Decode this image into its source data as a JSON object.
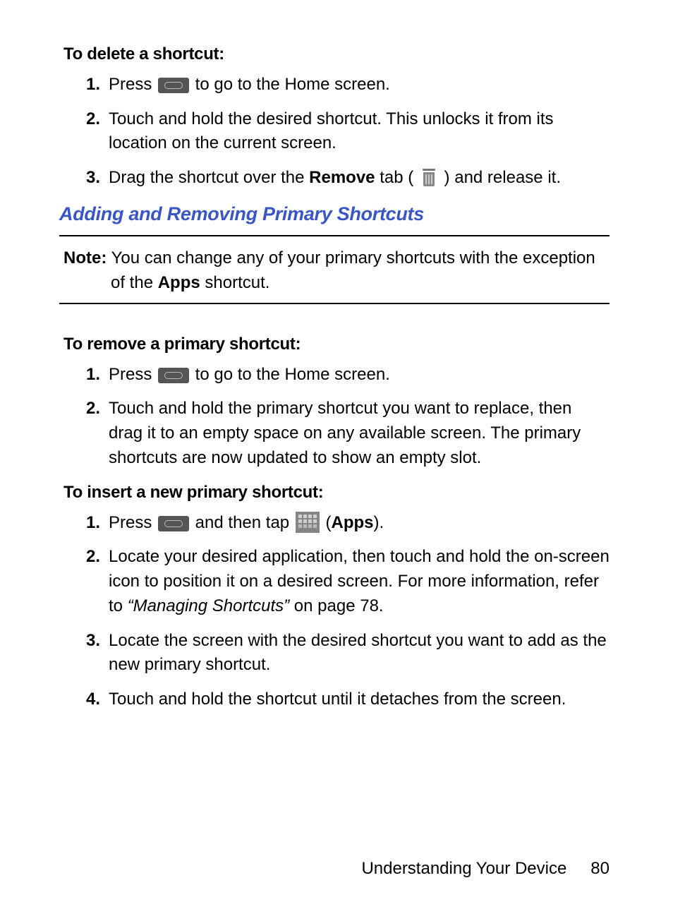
{
  "sec1": {
    "heading": "To delete a shortcut:",
    "items": {
      "i1a": "Press ",
      "i1b": " to go to the Home screen.",
      "i2": "Touch and hold the desired shortcut. This unlocks it from its location on the current screen.",
      "i3a": "Drag the shortcut over the ",
      "i3bold": "Remove",
      "i3b": " tab ( ",
      "i3c": " ) and release it."
    }
  },
  "blueHeading": "Adding and Removing Primary Shortcuts",
  "note": {
    "label": "Note:",
    "text1": " You can change any of your primary shortcuts with the exception of the ",
    "bold": "Apps",
    "text2": " shortcut."
  },
  "sec2": {
    "heading": "To remove a primary shortcut:",
    "items": {
      "i1a": "Press ",
      "i1b": " to go to the Home screen.",
      "i2": "Touch and hold the primary shortcut you want to replace, then drag it to an empty space on any available screen. The primary shortcuts are now updated to show an empty slot."
    }
  },
  "sec3": {
    "heading": "To insert a new primary shortcut:",
    "items": {
      "i1a": "Press ",
      "i1b": " and then tap ",
      "i1c": " (",
      "i1bold": "Apps",
      "i1d": ").",
      "i2a": "Locate your desired application, then touch and hold the on-screen icon to position it on a desired screen. For more information, refer to ",
      "i2ital": "“Managing Shortcuts”",
      "i2b": "  on page 78.",
      "i3": "Locate the screen with the desired shortcut you want to add as the new primary shortcut.",
      "i4": "Touch and hold the shortcut until it detaches from the screen."
    }
  },
  "footer": {
    "section": "Understanding Your Device",
    "page": "80"
  }
}
